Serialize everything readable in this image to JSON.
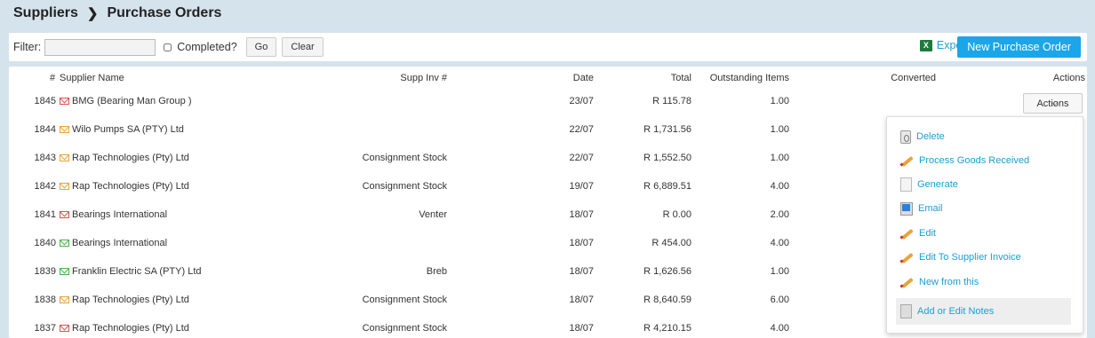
{
  "breadcrumb": {
    "root": "Suppliers",
    "current": "Purchase Orders"
  },
  "filter": {
    "label": "Filter:",
    "value": "",
    "completed_label": "Completed?",
    "go_label": "Go",
    "clear_label": "Clear"
  },
  "toolbar": {
    "export_label": "Export",
    "excel_glyph": "X",
    "new_po_label": "New Purchase Order"
  },
  "table": {
    "headers": {
      "num": "#",
      "supplier": "Supplier Name",
      "supp_inv": "Supp Inv #",
      "date": "Date",
      "total": "Total",
      "outstanding": "Outstanding Items",
      "converted": "Converted",
      "actions": "Actions"
    },
    "rows": [
      {
        "id": "1845",
        "supplier": "BMG (Bearing Man Group )",
        "env": "red",
        "supp_inv": "",
        "date": "23/07",
        "total": "R 115.78",
        "outstanding": "1.00"
      },
      {
        "id": "1844",
        "supplier": "Wilo Pumps SA (PTY) Ltd",
        "env": "orange",
        "supp_inv": "",
        "date": "22/07",
        "total": "R 1,731.56",
        "outstanding": "1.00"
      },
      {
        "id": "1843",
        "supplier": "Rap Technologies (Pty) Ltd",
        "env": "orange",
        "supp_inv": "Consignment Stock",
        "date": "22/07",
        "total": "R 1,552.50",
        "outstanding": "1.00"
      },
      {
        "id": "1842",
        "supplier": "Rap Technologies (Pty) Ltd",
        "env": "orange",
        "supp_inv": "Consignment Stock",
        "date": "19/07",
        "total": "R 6,889.51",
        "outstanding": "4.00"
      },
      {
        "id": "1841",
        "supplier": "Bearings International",
        "env": "red",
        "supp_inv": "Venter",
        "date": "18/07",
        "total": "R 0.00",
        "outstanding": "2.00"
      },
      {
        "id": "1840",
        "supplier": "Bearings International",
        "env": "green",
        "supp_inv": "",
        "date": "18/07",
        "total": "R 454.00",
        "outstanding": "4.00"
      },
      {
        "id": "1839",
        "supplier": "Franklin Electric SA (PTY) Ltd",
        "env": "green",
        "supp_inv": "Breb",
        "date": "18/07",
        "total": "R 1,626.56",
        "outstanding": "1.00"
      },
      {
        "id": "1838",
        "supplier": "Rap Technologies (Pty) Ltd",
        "env": "orange",
        "supp_inv": "Consignment Stock",
        "date": "18/07",
        "total": "R 8,640.59",
        "outstanding": "6.00"
      },
      {
        "id": "1837",
        "supplier": "Rap Technologies (Pty) Ltd",
        "env": "red",
        "supp_inv": "Consignment Stock",
        "date": "18/07",
        "total": "R 4,210.15",
        "outstanding": "4.00"
      }
    ],
    "actions_button_label": "Actions"
  },
  "actions_menu": {
    "items": [
      {
        "label": "Delete",
        "icon": "recycle-bin-icon"
      },
      {
        "label": "Process Goods Received",
        "icon": "pencil-icon"
      },
      {
        "label": "Generate",
        "icon": "document-icon"
      },
      {
        "label": "Email",
        "icon": "email-icon"
      },
      {
        "label": "Edit",
        "icon": "pencil-icon"
      },
      {
        "label": "Edit To Supplier Invoice",
        "icon": "pencil-icon"
      },
      {
        "label": "New from this",
        "icon": "pencil-icon"
      },
      {
        "label": "Add or Edit Notes",
        "icon": "notes-icon"
      }
    ],
    "highlighted_index": 7
  },
  "colors": {
    "background": "#d5e3ed",
    "accent": "#1aa6e8",
    "link": "#1a9fd2",
    "env_red": "#d9534f",
    "env_orange": "#e8a33d",
    "env_green": "#4caf50"
  }
}
